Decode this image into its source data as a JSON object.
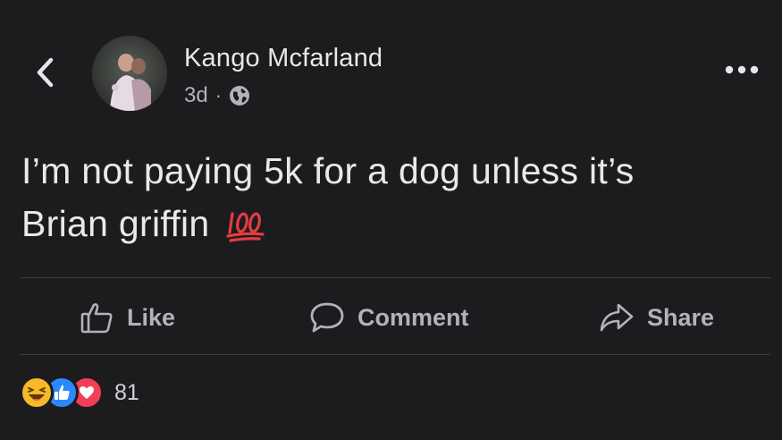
{
  "post": {
    "author_name": "Kango Mcfarland",
    "time_ago": "3d",
    "separator": "·",
    "text_line1": "I’m not paying 5k for a dog unless it’s",
    "text_line2": "Brian griffin",
    "emoji": "hundred-points-emoji"
  },
  "actions": {
    "like_label": "Like",
    "comment_label": "Comment",
    "share_label": "Share"
  },
  "reactions": {
    "types": [
      "haha",
      "like",
      "love"
    ],
    "count": "81"
  },
  "colors": {
    "background": "#1c1c1e",
    "text": "#e9e9eb",
    "muted": "#b0b3b8",
    "like_blue": "#2d88ff",
    "love_red": "#f33e58",
    "haha_yellow": "#f7b928"
  },
  "icons": {
    "back": "back-chevron-icon",
    "more": "more-options-icon",
    "privacy": "globe-icon",
    "like": "thumbs-up-icon",
    "comment": "comment-bubble-icon",
    "share": "share-arrow-icon"
  }
}
